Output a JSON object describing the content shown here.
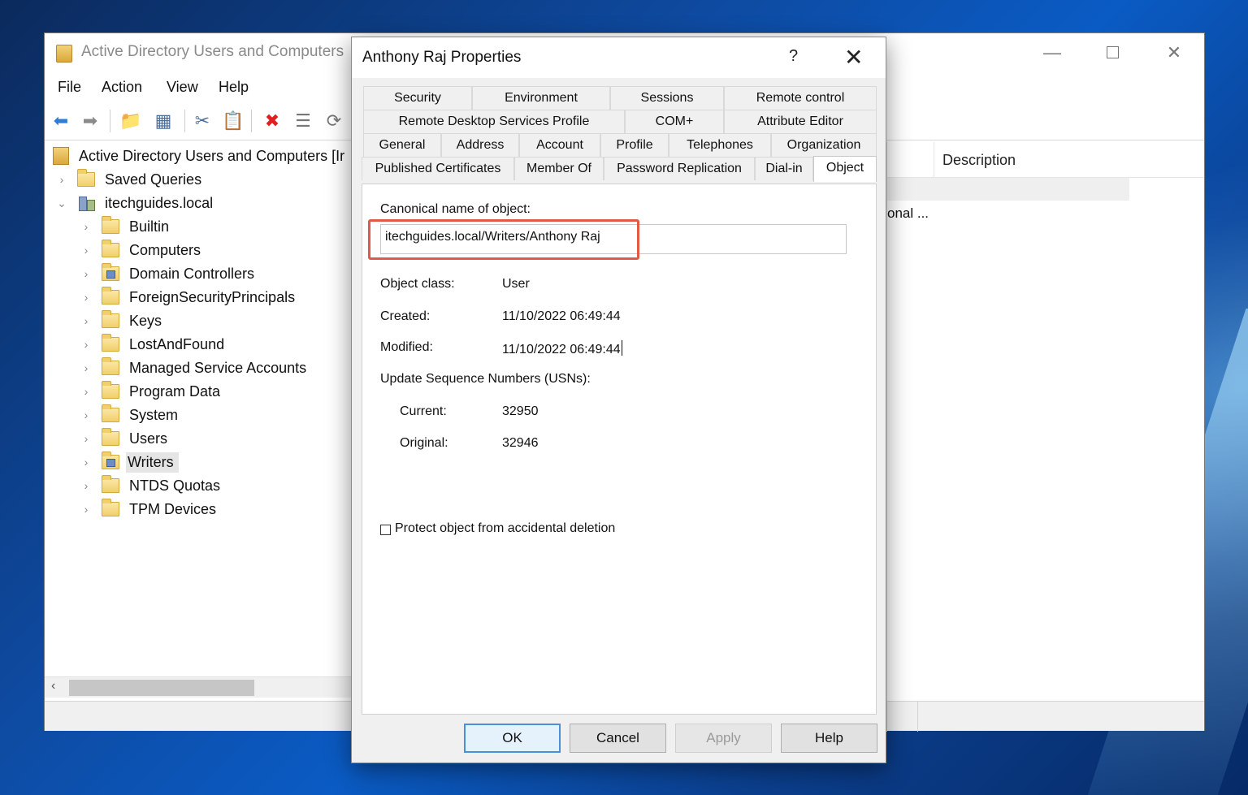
{
  "mmc": {
    "title": "Active Directory Users and Computers",
    "menu": [
      "File",
      "Action",
      "View",
      "Help"
    ],
    "toolbar_icons": [
      "back-arrow-icon",
      "forward-arrow-icon",
      "up-folder-icon",
      "show-hide-tree-icon",
      "cut-icon",
      "paste-icon",
      "delete-icon",
      "properties-icon",
      "refresh-icon"
    ],
    "tree": {
      "root": "Active Directory Users and Computers [Ir",
      "saved_queries": "Saved Queries",
      "domain": "itechguides.local",
      "children": [
        "Builtin",
        "Computers",
        "Domain Controllers",
        "ForeignSecurityPrincipals",
        "Keys",
        "LostAndFound",
        "Managed Service Accounts",
        "Program Data",
        "System",
        "Users",
        "Writers",
        "NTDS Quotas",
        "TPM Devices"
      ],
      "selected": "Writers"
    },
    "list": {
      "column_description": "Description",
      "cell_fragment": "onal ..."
    }
  },
  "dialog": {
    "title": "Anthony Raj Properties",
    "help_glyph": "?",
    "close_glyph": "✕",
    "tabs_row1": [
      "Security",
      "Environment",
      "Sessions",
      "Remote control"
    ],
    "tabs_row2": [
      "Remote Desktop Services Profile",
      "COM+",
      "Attribute Editor"
    ],
    "tabs_row3": [
      "General",
      "Address",
      "Account",
      "Profile",
      "Telephones",
      "Organization"
    ],
    "tabs_row4": [
      "Published Certificates",
      "Member Of",
      "Password Replication",
      "Dial-in",
      "Object"
    ],
    "active_tab": "Object",
    "object": {
      "canonical_label": "Canonical name of object:",
      "canonical_value": "itechguides.local/Writers/Anthony Raj",
      "class_label": "Object class:",
      "class_value": "User",
      "created_label": "Created:",
      "created_value": "11/10/2022 06:49:44",
      "modified_label": "Modified:",
      "modified_value": "11/10/2022 06:49:44",
      "usn_label": "Update Sequence Numbers (USNs):",
      "current_label": "Current:",
      "current_value": "32950",
      "original_label": "Original:",
      "original_value": "32946",
      "protect_label": "Protect object from accidental deletion",
      "protect_checked": false
    },
    "buttons": {
      "ok": "OK",
      "cancel": "Cancel",
      "apply": "Apply",
      "help": "Help"
    },
    "highlight_color": "#e05a45"
  }
}
